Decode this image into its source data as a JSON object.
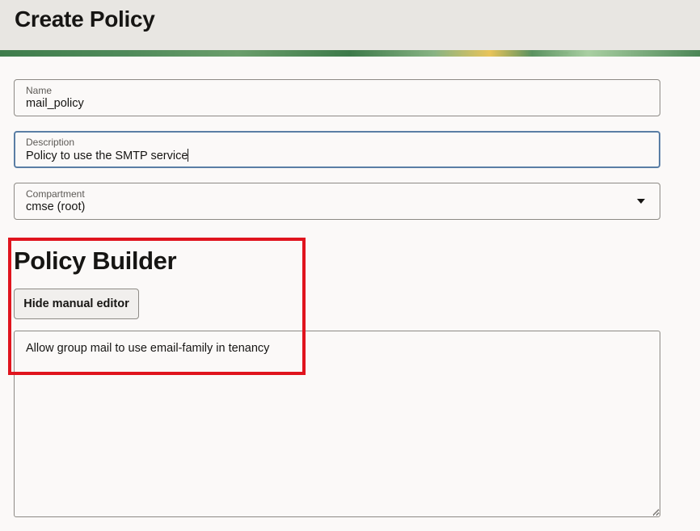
{
  "header": {
    "title": "Create Policy"
  },
  "form": {
    "name": {
      "label": "Name",
      "value": "mail_policy"
    },
    "description": {
      "label": "Description",
      "value": "Policy to use the SMTP service"
    },
    "compartment": {
      "label": "Compartment",
      "value": "cmse (root)"
    }
  },
  "policy_builder": {
    "title": "Policy Builder",
    "toggle_button_label": "Hide manual editor",
    "statement": "Allow group mail to use email-family in tenancy"
  },
  "colors": {
    "highlight": "#e0141e",
    "focus_border": "#5a7ea5",
    "header_bg": "#e8e6e2"
  }
}
